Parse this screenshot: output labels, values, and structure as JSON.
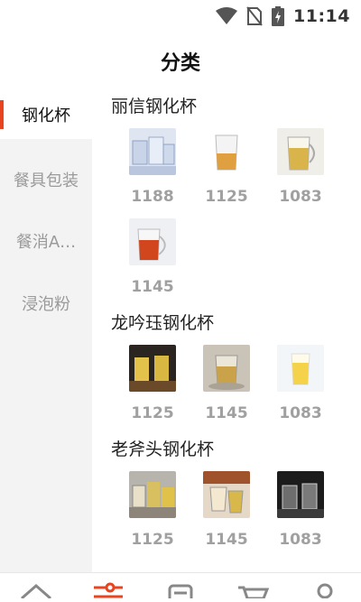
{
  "status_bar": {
    "time": "11:14"
  },
  "header": {
    "title": "分类"
  },
  "sidebar": {
    "items": [
      {
        "label": "钢化杯",
        "active": true
      },
      {
        "label": "餐具包装"
      },
      {
        "label": "餐消A…"
      },
      {
        "label": "浸泡粉"
      }
    ]
  },
  "sections": [
    {
      "title": "丽信钢化杯",
      "products": [
        {
          "count": "1188"
        },
        {
          "count": "1125"
        },
        {
          "count": "1083"
        },
        {
          "count": "1145"
        }
      ]
    },
    {
      "title": "龙吟珏钢化杯",
      "products": [
        {
          "count": "1125"
        },
        {
          "count": "1145"
        },
        {
          "count": "1083"
        }
      ]
    },
    {
      "title": "老斧头钢化杯",
      "products": [
        {
          "count": "1125"
        },
        {
          "count": "1145"
        },
        {
          "count": "1083"
        }
      ]
    }
  ],
  "tabbar": {
    "tabs": [
      {
        "icon": "home-icon"
      },
      {
        "icon": "category-icon",
        "active": true
      },
      {
        "icon": "orders-icon"
      },
      {
        "icon": "cart-icon"
      },
      {
        "icon": "profile-icon"
      }
    ]
  },
  "colors": {
    "accent": "#e8441f",
    "sidebar_bg": "#f3f3f3",
    "count_text": "#a0a0a0"
  }
}
